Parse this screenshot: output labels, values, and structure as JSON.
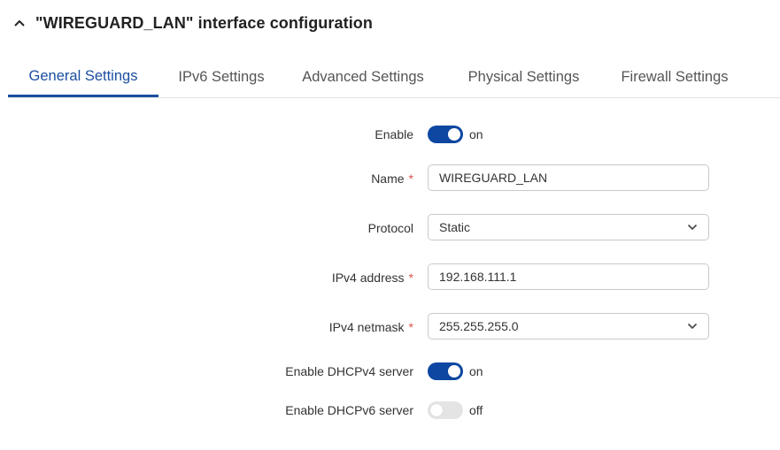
{
  "header": {
    "title": "\"WIREGUARD_LAN\" interface configuration",
    "collapse_icon": "chevron-up-icon"
  },
  "tabs": [
    {
      "label": "General Settings",
      "active": true
    },
    {
      "label": "IPv6 Settings",
      "active": false
    },
    {
      "label": "Advanced Settings",
      "active": false
    },
    {
      "label": "Physical Settings",
      "active": false
    },
    {
      "label": "Firewall Settings",
      "active": false
    }
  ],
  "form": {
    "enable": {
      "label": "Enable",
      "state": "on"
    },
    "name": {
      "label": "Name",
      "required_mark": "*",
      "value": "WIREGUARD_LAN"
    },
    "protocol": {
      "label": "Protocol",
      "value": "Static"
    },
    "ipv4_address": {
      "label": "IPv4 address",
      "required_mark": "*",
      "value": "192.168.111.1"
    },
    "ipv4_netmask": {
      "label": "IPv4 netmask",
      "required_mark": "*",
      "value": "255.255.255.0"
    },
    "dhcpv4": {
      "label": "Enable DHCPv4 server",
      "state": "on"
    },
    "dhcpv6": {
      "label": "Enable DHCPv6 server",
      "state": "off"
    }
  },
  "colors": {
    "accent": "#1b4fa0",
    "toggle_on": "#0d47a1",
    "required": "#d9534f"
  }
}
